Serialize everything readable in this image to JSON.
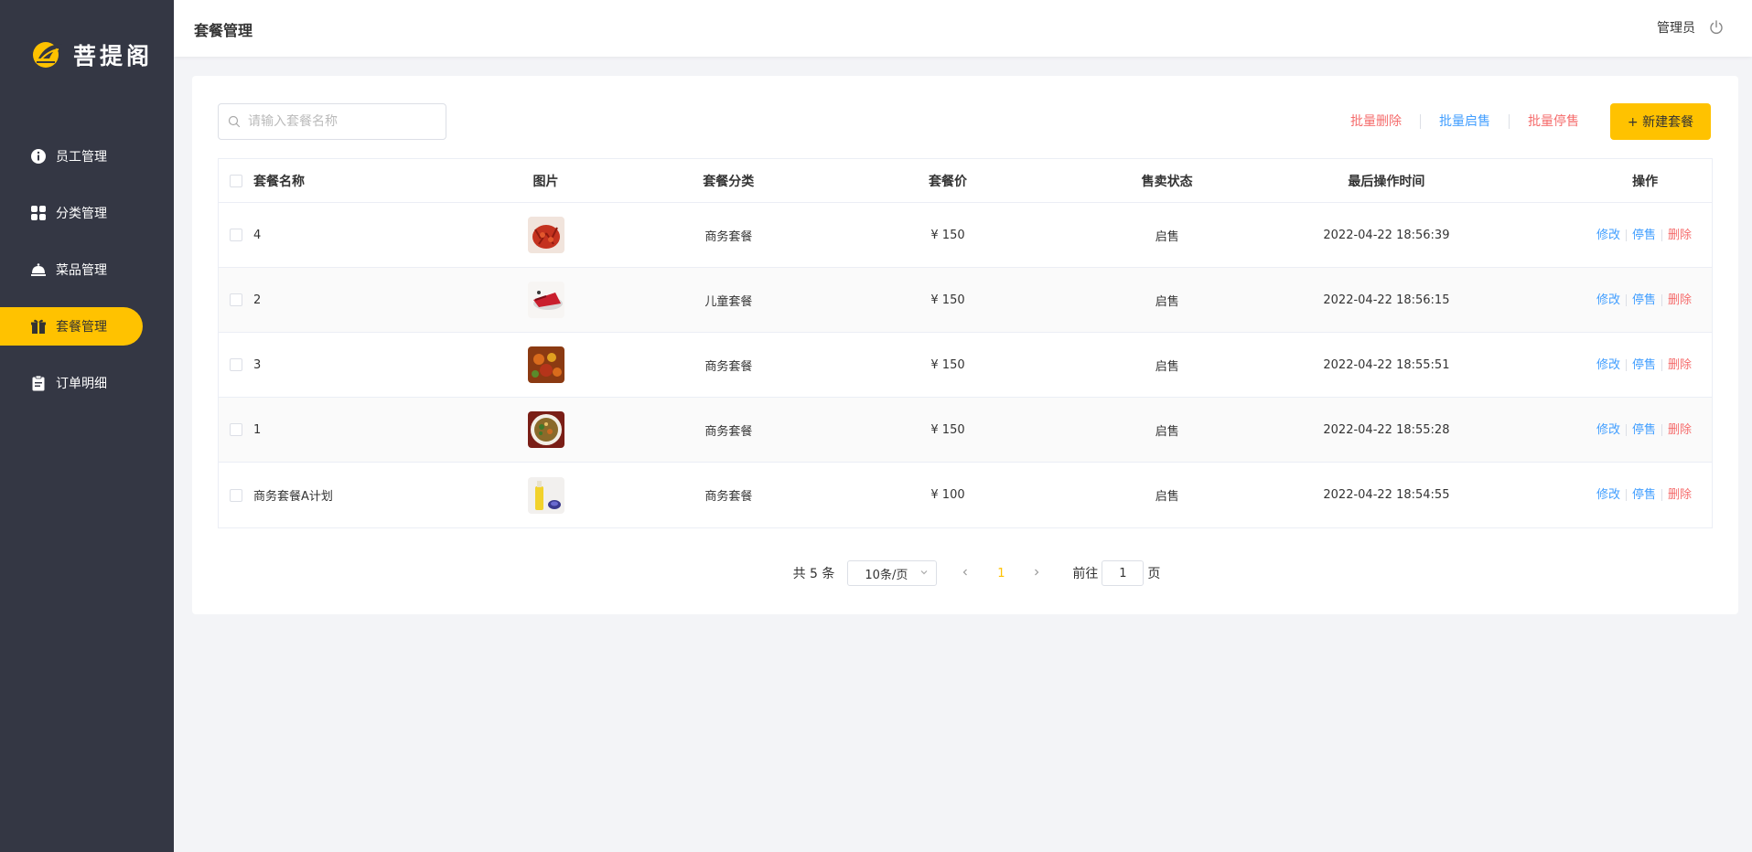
{
  "app": {
    "logo_text": "菩提阁"
  },
  "sidebar": {
    "items": [
      {
        "label": "员工管理",
        "icon": "info-icon",
        "active": false
      },
      {
        "label": "分类管理",
        "icon": "grid-icon",
        "active": false
      },
      {
        "label": "菜品管理",
        "icon": "dish-icon",
        "active": false
      },
      {
        "label": "套餐管理",
        "icon": "gift-icon",
        "active": true
      },
      {
        "label": "订单明细",
        "icon": "clipboard-icon",
        "active": false
      }
    ]
  },
  "header": {
    "title": "套餐管理",
    "user": "管理员",
    "logout_icon": "power-icon"
  },
  "search": {
    "placeholder": "请输入套餐名称",
    "value": ""
  },
  "toolbar": {
    "batch_delete": "批量删除",
    "batch_enable": "批量启售",
    "batch_disable": "批量停售",
    "new_button": "+ 新建套餐"
  },
  "table": {
    "columns": [
      "套餐名称",
      "图片",
      "套餐分类",
      "套餐价",
      "售卖状态",
      "最后操作时间",
      "操作"
    ],
    "rows": [
      {
        "name": "4",
        "image": "crayfish",
        "category": "商务套餐",
        "price": "¥ 150",
        "status": "启售",
        "time": "2022-04-22 18:56:39"
      },
      {
        "name": "2",
        "image": "fish-plate",
        "category": "儿童套餐",
        "price": "¥ 150",
        "status": "启售",
        "time": "2022-04-22 18:56:15"
      },
      {
        "name": "3",
        "image": "spicy-dish",
        "category": "商务套餐",
        "price": "¥ 150",
        "status": "启售",
        "time": "2022-04-22 18:55:51"
      },
      {
        "name": "1",
        "image": "bowl-dish",
        "category": "商务套餐",
        "price": "¥ 150",
        "status": "启售",
        "time": "2022-04-22 18:55:28"
      },
      {
        "name": "商务套餐A计划",
        "image": "drinks",
        "category": "商务套餐",
        "price": "¥ 100",
        "status": "启售",
        "time": "2022-04-22 18:54:55"
      }
    ],
    "ops": {
      "edit": "修改",
      "disable": "停售",
      "delete": "删除"
    }
  },
  "pagination": {
    "total": "共 5 条",
    "page_size": "10条/页",
    "current_page": "1",
    "goto_prefix": "前往",
    "goto_value": "1",
    "goto_suffix": "页"
  },
  "colors": {
    "accent": "#ffc200",
    "sidebar_bg": "#343744",
    "link_blue": "#419eff",
    "danger_red": "#f56c6c"
  }
}
